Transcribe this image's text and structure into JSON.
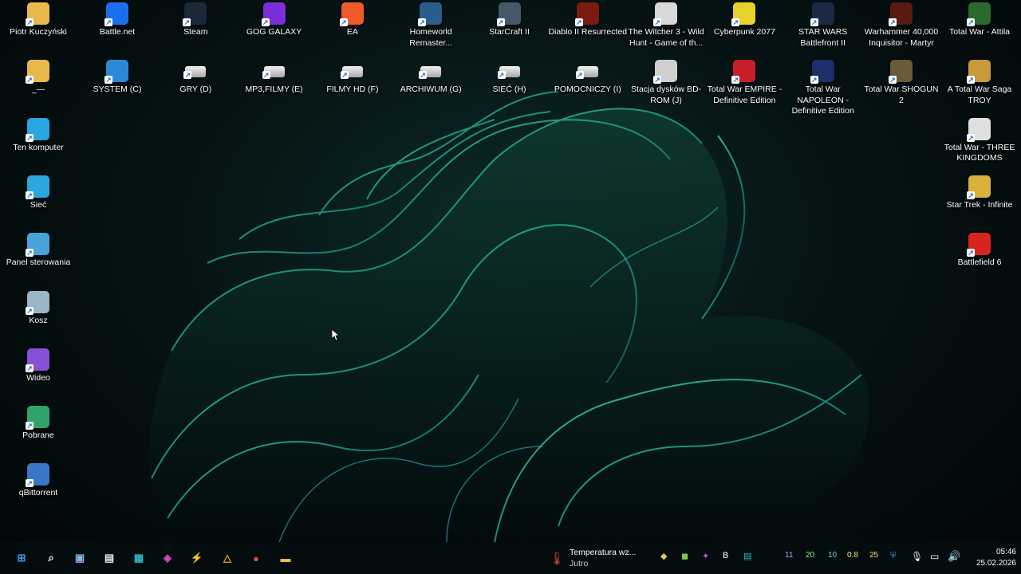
{
  "desktop": {
    "left_icons": [
      {
        "label": "Piotr Kuczyński",
        "icon": "user-folder-icon",
        "color": "#e8b84a"
      },
      {
        "label": "_—",
        "icon": "folder-icon",
        "color": "#e8b84a"
      },
      {
        "label": "Ten komputer",
        "icon": "computer-icon",
        "color": "#2aa7e0"
      },
      {
        "label": "Sieć",
        "icon": "network-icon",
        "color": "#2aa7e0"
      },
      {
        "label": "Panel sterowania",
        "icon": "control-panel-icon",
        "color": "#4aa3d8"
      },
      {
        "label": "Kosz",
        "icon": "recycle-bin-icon",
        "color": "#9ab6c8"
      },
      {
        "label": "Wideo",
        "icon": "video-folder-icon",
        "color": "#8a4fd8"
      },
      {
        "label": "Pobrane",
        "icon": "downloads-folder-icon",
        "color": "#2fa36b"
      },
      {
        "label": "qBittorrent",
        "icon": "qbittorrent-icon",
        "color": "#3a76c8"
      }
    ],
    "top_row": [
      {
        "label": "Battle.net",
        "icon": "battlenet-icon",
        "color": "#1a6ff0"
      },
      {
        "label": "Steam",
        "icon": "steam-icon",
        "color": "#1b2838"
      },
      {
        "label": "GOG GALAXY",
        "icon": "gog-galaxy-icon",
        "color": "#7b2fd8"
      },
      {
        "label": "EA",
        "icon": "ea-icon",
        "color": "#f05a28"
      },
      {
        "label": "Homeworld Remaster...",
        "icon": "homeworld-icon",
        "color": "#2a5d8a"
      },
      {
        "label": "StarCraft II",
        "icon": "starcraft-icon",
        "color": "#44586a"
      },
      {
        "label": "Diablo II Resurrected",
        "icon": "diablo-icon",
        "color": "#7a1a10"
      },
      {
        "label": "The Witcher 3 - Wild Hunt - Game of th...",
        "icon": "witcher-icon",
        "color": "#d8d8d8"
      },
      {
        "label": "Cyberpunk 2077",
        "icon": "cyberpunk-icon",
        "color": "#e6d42a"
      },
      {
        "label": "STAR WARS Battlefront II",
        "icon": "battlefront-icon",
        "color": "#1a2a44"
      },
      {
        "label": "Warhammer 40,000 Inquisitor - Martyr",
        "icon": "warhammer-icon",
        "color": "#5a1a10"
      }
    ],
    "second_row": [
      {
        "label": "SYSTEM (C)",
        "icon": "system-drive-icon",
        "color": "#2a8ad8"
      },
      {
        "label": "GRY (D)",
        "icon": "drive-icon",
        "color": "#cfcfcf"
      },
      {
        "label": "MP3,FILMY (E)",
        "icon": "drive-icon",
        "color": "#cfcfcf"
      },
      {
        "label": "FILMY HD (F)",
        "icon": "drive-icon",
        "color": "#cfcfcf"
      },
      {
        "label": "ARCHIWUM (G)",
        "icon": "drive-icon",
        "color": "#cfcfcf"
      },
      {
        "label": "SIEĆ (H)",
        "icon": "drive-icon",
        "color": "#cfcfcf"
      },
      {
        "label": "POMOCNICZY (I)",
        "icon": "drive-icon",
        "color": "#cfcfcf"
      },
      {
        "label": "Stacja dysków BD-ROM (J)",
        "icon": "bd-rom-icon",
        "color": "#cfcfcf"
      },
      {
        "label": "Total War EMPIRE - Definitive Edition",
        "icon": "total-war-empire-icon",
        "color": "#c81e2a"
      },
      {
        "label": "Total War NAPOLEON - Definitive Edition",
        "icon": "total-war-napoleon-icon",
        "color": "#1e2e6a"
      },
      {
        "label": "Total War SHOGUN 2",
        "icon": "total-war-shogun-icon",
        "color": "#6a5a3a"
      }
    ],
    "right_icons": [
      {
        "label": "Total War - Attila",
        "icon": "total-war-attila-icon",
        "color": "#2a6a2a"
      },
      {
        "label": "A Total War Saga TROY",
        "icon": "troy-icon",
        "color": "#c89a3a"
      },
      {
        "label": "Total War - THREE KINGDOMS",
        "icon": "three-kingdoms-icon",
        "color": "#e0e0e0"
      },
      {
        "label": "Star Trek - Infinite",
        "icon": "star-trek-icon",
        "color": "#d8b03a"
      },
      {
        "label": "Battlefield 6",
        "icon": "battlefield-icon",
        "color": "#d8241e"
      }
    ]
  },
  "taskbar": {
    "apps": [
      {
        "name": "start-button",
        "glyph": "⊞",
        "color": "#2f9bef"
      },
      {
        "name": "search-icon",
        "glyph": "⌕",
        "color": "#ffffff"
      },
      {
        "name": "app-icon",
        "glyph": "▣",
        "color": "#8ab4e8"
      },
      {
        "name": "notepad-icon",
        "glyph": "▤",
        "color": "#e8e8e8"
      },
      {
        "name": "cpu-monitor-icon",
        "glyph": "▦",
        "color": "#2ab8c8"
      },
      {
        "name": "gpu-tool-icon",
        "glyph": "◈",
        "color": "#d84ac8"
      },
      {
        "name": "winrar-icon",
        "glyph": "⚡",
        "color": "#e8c84a"
      },
      {
        "name": "warning-app-icon",
        "glyph": "△",
        "color": "#f0a020"
      },
      {
        "name": "chrome-icon",
        "glyph": "●",
        "color": "#e04a3a"
      },
      {
        "name": "explorer-icon",
        "glyph": "▬",
        "color": "#f0c040"
      }
    ],
    "weather": {
      "title": "Temperatura wz...",
      "subtitle": "Jutro"
    },
    "tray": {
      "icons": [
        "nvidia-icon",
        "color-tool-icon",
        "bold-b-icon",
        "screen-icon",
        "chrome-small-icon"
      ],
      "numbers": [
        {
          "value": "11",
          "color": "#9ab0ff"
        },
        {
          "value": "20",
          "color": "#7cff7c"
        },
        {
          "value": "10",
          "color": "#6ad8ff"
        },
        {
          "value": "0.8",
          "color": "#e8e070"
        },
        {
          "value": "25",
          "color": "#ffd070"
        }
      ],
      "time": "05:46",
      "date": "25.02.2026"
    }
  }
}
